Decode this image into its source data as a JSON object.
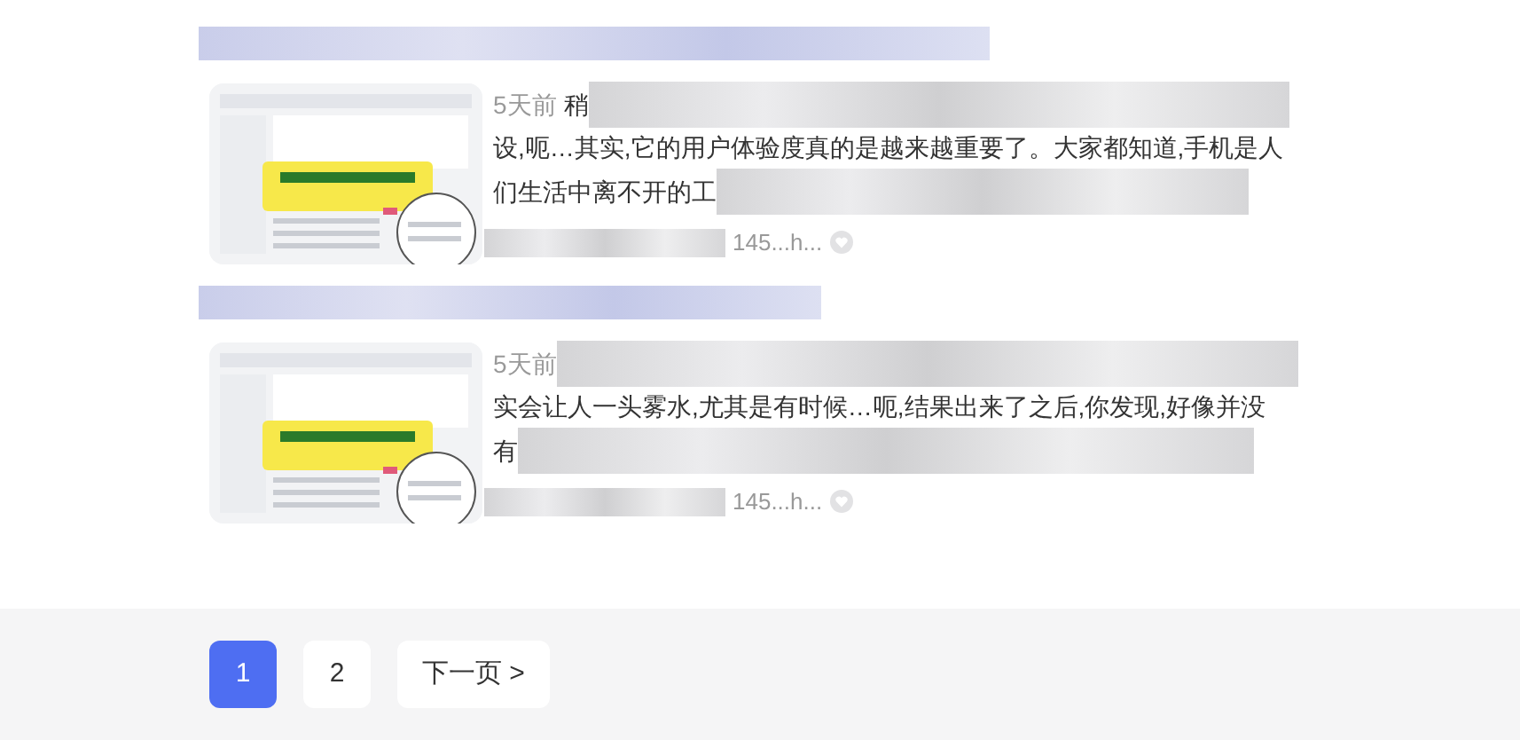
{
  "results": [
    {
      "time": "5天前",
      "title_start": "稍",
      "lines": [
        "设,呃…其实,它的用户体验度真的是越来越重要了。大家都知道,手机是人",
        "们生活中离不开的工"
      ],
      "source": "145...h..."
    },
    {
      "time": "5天前",
      "lines": [
        "实会让人一头雾水,尤其是有时候…呃,结果出来了之后,你发现,好像并没",
        "有"
      ],
      "source": "145...h..."
    }
  ],
  "pagination": {
    "pages": [
      {
        "label": "1",
        "selected": true
      },
      {
        "label": "2",
        "selected": false
      }
    ],
    "next": "下一页 >"
  }
}
